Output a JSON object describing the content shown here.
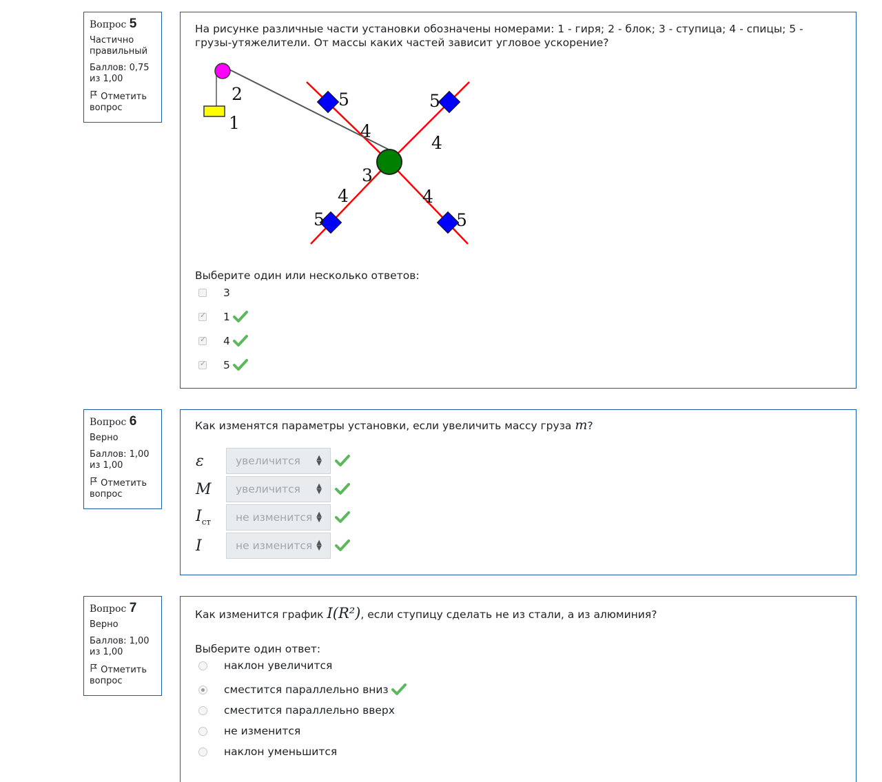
{
  "q5": {
    "label": "Вопрос",
    "number": "5",
    "state": "Частично правильный",
    "grade": "Баллов: 0,75 из 1,00",
    "flag_label": "Отметить вопрос",
    "text": "На рисунке различные части установки обозначены  номерами: 1 - гиря; 2 - блок; 3 - ступица; 4 - спицы; 5 - грузы-утяжелители. От массы каких частей зависит угловое ускорение?",
    "diagram_labels": {
      "weight": "1",
      "pulley": "2",
      "hub": "3",
      "spoke": "4",
      "load": "5"
    },
    "prompt": "Выберите один или несколько ответов:",
    "options": [
      {
        "label": "3",
        "checked": false,
        "correct": false
      },
      {
        "label": "1",
        "checked": true,
        "correct": true
      },
      {
        "label": "4",
        "checked": true,
        "correct": true
      },
      {
        "label": "5",
        "checked": true,
        "correct": true
      }
    ]
  },
  "q6": {
    "label": "Вопрос",
    "number": "6",
    "state": "Верно",
    "grade": "Баллов: 1,00 из 1,00",
    "flag_label": "Отметить вопрос",
    "text_before": "Как изменятся параметры установки, если увеличить массу груза ",
    "text_math": "m",
    "text_after": "?",
    "rows": [
      {
        "symbol": "ε",
        "sub": "",
        "value": "увеличится"
      },
      {
        "symbol": "M",
        "sub": "",
        "value": "увеличится"
      },
      {
        "symbol": "I",
        "sub": "ст",
        "value": "не изменится"
      },
      {
        "symbol": "I",
        "sub": "",
        "value": "не изменится"
      }
    ]
  },
  "q7": {
    "label": "Вопрос",
    "number": "7",
    "state": "Верно",
    "grade": "Баллов: 1,00 из 1,00",
    "flag_label": "Отметить вопрос",
    "text_before": "Как изменится график ",
    "text_math": "I(R²)",
    "text_after": ", если ступицу сделать не из стали, а из алюминия?",
    "prompt": "Выберите один ответ:",
    "options": [
      {
        "label": "наклон увеличится",
        "selected": false,
        "correct": false
      },
      {
        "label": "сместится параллельно вниз",
        "selected": true,
        "correct": true
      },
      {
        "label": "сместится параллельно вверх",
        "selected": false,
        "correct": false
      },
      {
        "label": "не изменится",
        "selected": false,
        "correct": false
      },
      {
        "label": "наклон уменьшится",
        "selected": false,
        "correct": false
      }
    ]
  },
  "colors": {
    "border": "#1a5aa6",
    "correct": "#5cb85c",
    "pulley": "#ff00ff",
    "weight": "#ffff00",
    "hub": "#008000",
    "load": "#0000ff",
    "spoke": "#ff0000"
  }
}
